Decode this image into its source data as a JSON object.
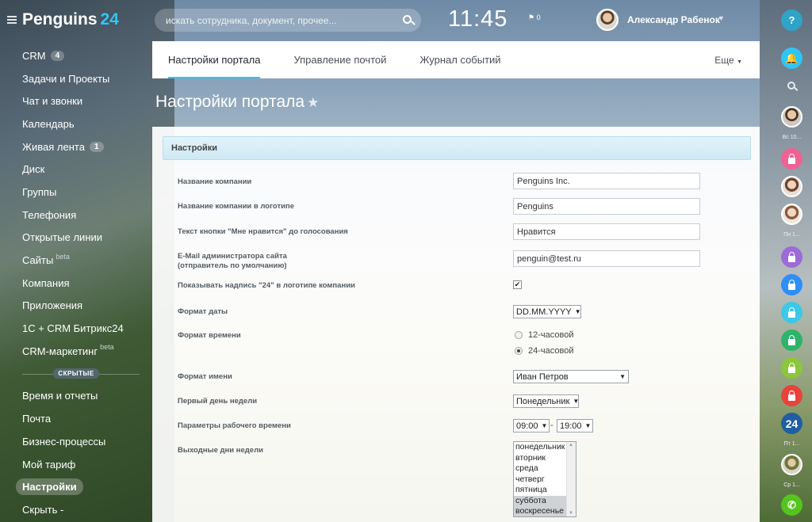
{
  "app": {
    "logo_text": "Penguins",
    "logo_num": "24"
  },
  "sidebar": {
    "items": [
      {
        "label": "CRM",
        "count": "4"
      },
      {
        "label": "Задачи и Проекты"
      },
      {
        "label": "Чат и звонки"
      },
      {
        "label": "Календарь"
      },
      {
        "label": "Живая лента",
        "count": "1"
      },
      {
        "label": "Диск"
      },
      {
        "label": "Группы"
      },
      {
        "label": "Телефония"
      },
      {
        "label": "Открытые линии"
      },
      {
        "label": "Сайты",
        "beta": "beta"
      },
      {
        "label": "Компания"
      },
      {
        "label": "Приложения"
      },
      {
        "label": "1С + CRM Битрикс24"
      },
      {
        "label": "CRM-маркетинг",
        "beta": "beta"
      }
    ],
    "hidden_label": "СКРЫТЫЕ",
    "hidden_items": [
      {
        "label": "Время и отчеты"
      },
      {
        "label": "Почта"
      },
      {
        "label": "Бизнес-процессы"
      },
      {
        "label": "Мой тариф"
      },
      {
        "label": "Настройки",
        "active": true
      },
      {
        "label": "Скрыть -"
      }
    ]
  },
  "header": {
    "search_placeholder": "искать сотрудника, документ, прочее...",
    "clock": "11:45",
    "flag_count": "0",
    "user_name": "Александр Рабенок"
  },
  "tabs": {
    "items": [
      "Настройки портала",
      "Управление почтой",
      "Журнал событий"
    ],
    "active": "Настройки портала",
    "more": "Еще"
  },
  "page": {
    "title": "Настройки портала"
  },
  "settings": {
    "section_title": "Настройки",
    "company_name_label": "Название компании",
    "company_name_value": "Penguins Inc.",
    "logo_name_label": "Название компании в логотипе",
    "logo_name_value": "Penguins",
    "like_button_label": "Текст кнопки \"Мне нравится\" до голосования",
    "like_button_value": "Нравится",
    "email_label_1": "E-Mail администратора сайта",
    "email_label_2": "(отправитель по умолчанию)",
    "email_value": "penguin@test.ru",
    "show24_label": "Показывать надпись \"24\" в логотипе компании",
    "show24_checked": true,
    "date_format_label": "Формат даты",
    "date_format_value": "DD.MM.YYYY",
    "time_format_label": "Формат времени",
    "time_format_options": [
      "12-часовой",
      "24-часовой"
    ],
    "time_format_selected": "24-часовой",
    "name_format_label": "Формат имени",
    "name_format_value": "Иван Петров",
    "week_start_label": "Первый день недели",
    "week_start_value": "Понедельник",
    "work_hours_label": "Параметры рабочего времени",
    "work_from": "09:00",
    "work_to": "19:00",
    "weekend_label": "Выходные дни недели",
    "weekdays": [
      "понедельник",
      "вторник",
      "среда",
      "четверг",
      "пятница",
      "суббота",
      "воскресенье"
    ],
    "weekend_selected": [
      "суббота",
      "воскресенье"
    ]
  },
  "rightbar": {
    "help": "?",
    "labels": [
      "Вс 10...",
      "Пн 1...",
      "Пт 1...",
      "Ср 1..."
    ],
    "b24": "24",
    "colors": {
      "help": "#2fa3c8",
      "bell": "#2fc6f6",
      "pink": "#f06292",
      "purple": "#9c6bd8",
      "blue": "#2f8ef6",
      "cyan": "#3cc8e6",
      "green": "#2db46a",
      "lime": "#8cc63f",
      "red": "#e8433b",
      "b24": "#1f5fa0",
      "phone": "#55c51e"
    }
  }
}
